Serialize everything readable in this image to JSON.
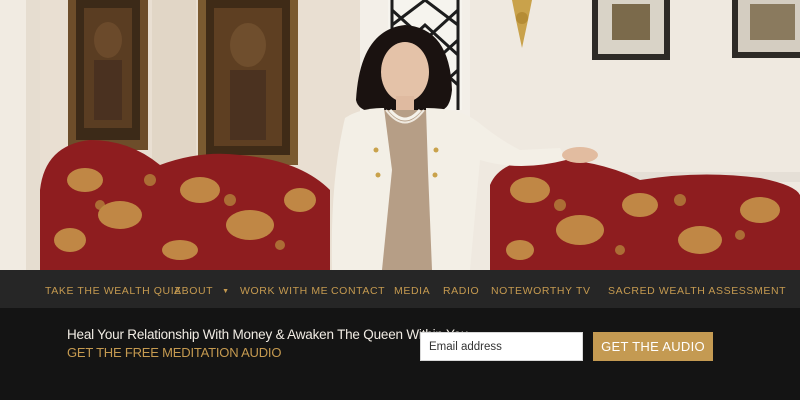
{
  "nav": {
    "items": [
      {
        "label": "TAKE THE WEALTH QUIZ"
      },
      {
        "label": "ABOUT"
      },
      {
        "label": "WORK WITH ME"
      },
      {
        "label": "CONTACT"
      },
      {
        "label": "MEDIA"
      },
      {
        "label": "RADIO"
      },
      {
        "label": "NOTEWORTHY"
      },
      {
        "label": "TV"
      },
      {
        "label": "SACRED WEALTH ASSESSMENT"
      }
    ],
    "about_caret_icon": "caret-down-icon"
  },
  "optin": {
    "headline": "Heal Your Relationship With Money & Awaken The Queen Within You",
    "subheadline": "GET THE FREE MEDITATION AUDIO",
    "email_placeholder": "Email address",
    "button_label": "GET THE AUDIO"
  },
  "colors": {
    "gold_accent": "#c49a52",
    "nav_background": "#262626",
    "optin_background": "#141414"
  }
}
